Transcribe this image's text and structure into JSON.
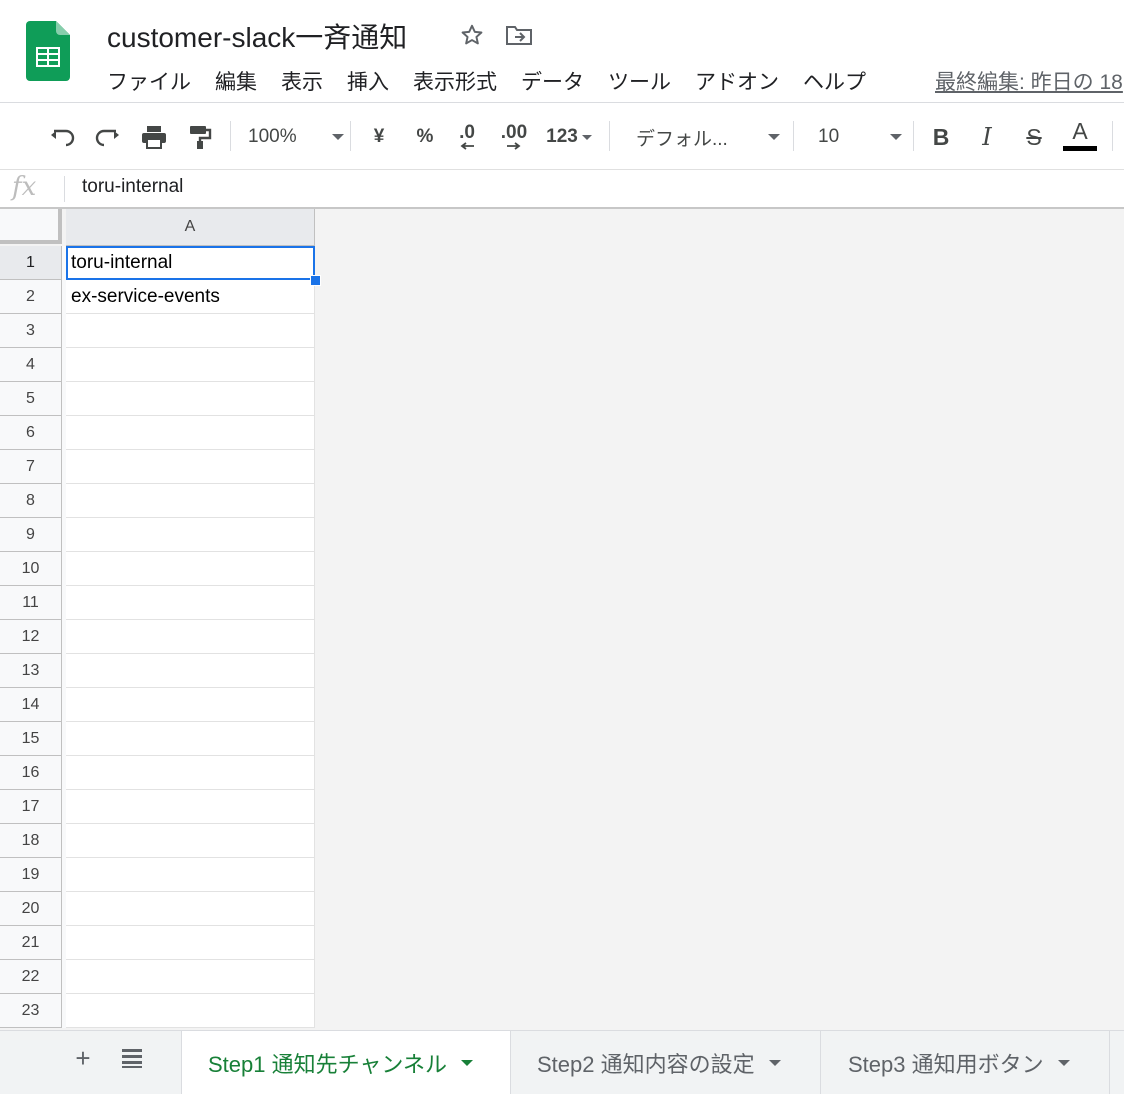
{
  "app": {
    "document_title": "customer-slack一斉通知",
    "last_edit": "最終編集: 昨日の 18",
    "icons": {
      "logo": "sheets-logo-icon",
      "star": "star-icon",
      "move": "move-to-folder-icon"
    }
  },
  "menu": [
    "ファイル",
    "編集",
    "表示",
    "挿入",
    "表示形式",
    "データ",
    "ツール",
    "アドオン",
    "ヘルプ"
  ],
  "toolbar": {
    "zoom": "100%",
    "currency": "¥",
    "percent": "%",
    "decrease_decimal": ".0",
    "increase_decimal": ".00",
    "more_formats": "123",
    "font": "デフォル...",
    "font_size": "10",
    "bold": "B",
    "italic": "I",
    "strike": "S",
    "text_color": "A",
    "text_color_value": "#000000"
  },
  "formula_bar": {
    "fx_label": "fx",
    "value": "toru-internal"
  },
  "grid": {
    "column_header": "A",
    "rows": [
      {
        "num": "1",
        "a": "toru-internal"
      },
      {
        "num": "2",
        "a": "ex-service-events"
      },
      {
        "num": "3",
        "a": ""
      },
      {
        "num": "4",
        "a": ""
      },
      {
        "num": "5",
        "a": ""
      },
      {
        "num": "6",
        "a": ""
      },
      {
        "num": "7",
        "a": ""
      },
      {
        "num": "8",
        "a": ""
      },
      {
        "num": "9",
        "a": ""
      },
      {
        "num": "10",
        "a": ""
      },
      {
        "num": "11",
        "a": ""
      },
      {
        "num": "12",
        "a": ""
      },
      {
        "num": "13",
        "a": ""
      },
      {
        "num": "14",
        "a": ""
      },
      {
        "num": "15",
        "a": ""
      },
      {
        "num": "16",
        "a": ""
      },
      {
        "num": "17",
        "a": ""
      },
      {
        "num": "18",
        "a": ""
      },
      {
        "num": "19",
        "a": ""
      },
      {
        "num": "20",
        "a": ""
      },
      {
        "num": "21",
        "a": ""
      },
      {
        "num": "22",
        "a": ""
      },
      {
        "num": "23",
        "a": ""
      }
    ],
    "selected_cell": "A1"
  },
  "sheet_tabs": {
    "add_label": "+",
    "tabs": [
      {
        "label": "Step1 通知先チャンネル",
        "active": true
      },
      {
        "label": "Step2 通知内容の設定",
        "active": false
      },
      {
        "label": "Step3 通知用ボタン",
        "active": false
      }
    ]
  },
  "colors": {
    "selection": "#1a73e8",
    "active_tab": "#188038",
    "sheets_green": "#0f9d58"
  }
}
